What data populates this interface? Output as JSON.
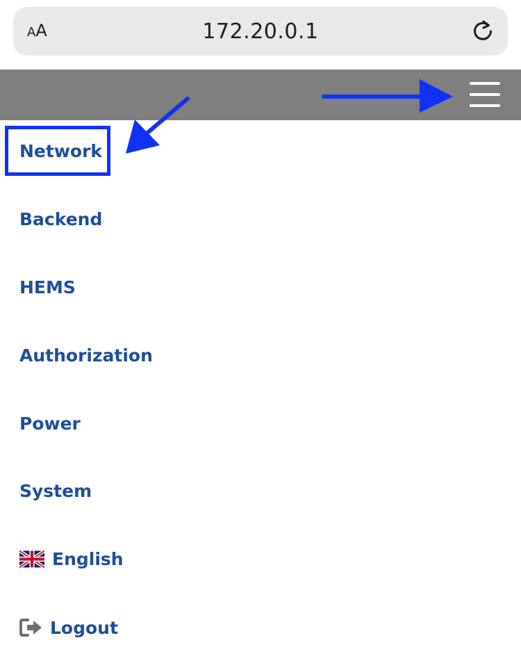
{
  "browser": {
    "text_size_label_small": "A",
    "text_size_label_large": "A",
    "url": "172.20.0.1",
    "reload_icon": "reload-icon"
  },
  "header": {
    "menu_icon": "hamburger-menu-icon",
    "background_color": "#7f7f7f"
  },
  "menu": {
    "items": [
      {
        "label": "Network"
      },
      {
        "label": "Backend"
      },
      {
        "label": "HEMS"
      },
      {
        "label": "Authorization"
      },
      {
        "label": "Power"
      },
      {
        "label": "System"
      },
      {
        "label": "English",
        "icon": "uk-flag-icon"
      },
      {
        "label": "Logout",
        "icon": "logout-icon"
      }
    ],
    "link_color": "#1f4e99"
  },
  "annotations": {
    "color": "#1032f5",
    "highlighted_item": "Network"
  }
}
